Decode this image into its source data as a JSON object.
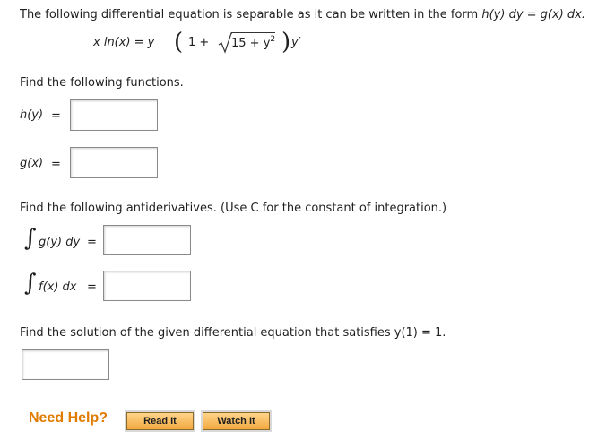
{
  "intro": {
    "prefix": "The following differential equation is separable as it can be written in the form ",
    "form": "h(y) dy = g(x) dx."
  },
  "equation": {
    "lhs": "x ln(x) = y",
    "open_paren": "(",
    "one_plus": "1 +",
    "radicand_text": "15 + y",
    "exponent": "2",
    "close_paren": ")",
    "tail": "y′"
  },
  "find_functions": {
    "heading": "Find the following functions.",
    "h_label": "h(y)",
    "g_label": "g(x)",
    "equals": "="
  },
  "antiderivatives": {
    "heading": "Find the following antiderivatives. (Use C for the constant of integration.)",
    "integral_symbol": "∫",
    "g_integrand": "g(y) dy",
    "f_integrand": "f(x) dx",
    "equals": "="
  },
  "solution": {
    "heading": "Find the solution of the given differential equation that satisfies y(1) = 1."
  },
  "help": {
    "need_help": "Need Help?",
    "read_it": "Read It",
    "watch_it": "Watch It"
  }
}
